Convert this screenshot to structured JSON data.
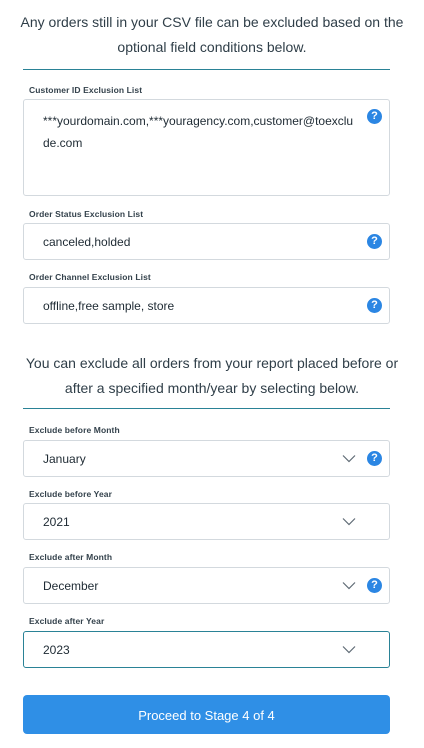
{
  "intro_top": "Any orders still in your CSV file can be excluded based on the optional field conditions below.",
  "fields": {
    "customer_id": {
      "label": "Customer ID Exclusion List",
      "value": "***yourdomain.com,***youragency.com,customer@toexclude.com"
    },
    "order_status": {
      "label": "Order Status Exclusion List",
      "value": "canceled,holded"
    },
    "order_channel": {
      "label": "Order Channel Exclusion List",
      "value": "offline,free sample, store"
    }
  },
  "intro_bottom": "You can exclude all orders from your report placed before or after a specified month/year by selecting below.",
  "selects": {
    "before_month": {
      "label": "Exclude before Month",
      "value": "January"
    },
    "before_year": {
      "label": "Exclude before Year",
      "value": "2021"
    },
    "after_month": {
      "label": "Exclude after Month",
      "value": "December"
    },
    "after_year": {
      "label": "Exclude after Year",
      "value": "2023"
    }
  },
  "help_glyph": "?",
  "proceed_button": "Proceed to Stage 4 of 4"
}
